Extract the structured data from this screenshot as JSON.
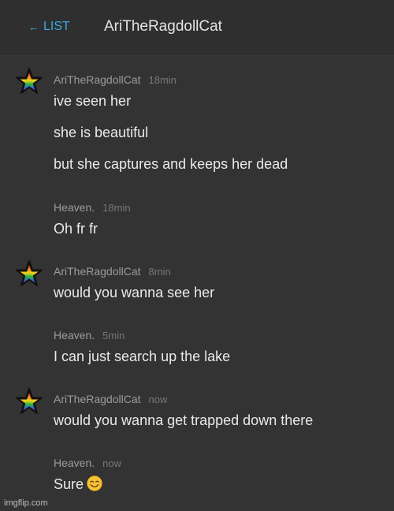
{
  "header": {
    "back_arrow": "←",
    "back_label": "LIST",
    "title": "AriTheRagdollCat"
  },
  "messages": [
    {
      "username": "AriTheRagdollCat",
      "time": "18min",
      "has_avatar": true,
      "lines": [
        "ive seen her",
        "she is beautiful",
        "but she captures and keeps her dead"
      ]
    },
    {
      "username": "Heaven.",
      "time": "18min",
      "has_avatar": false,
      "lines": [
        "Oh fr fr"
      ]
    },
    {
      "username": "AriTheRagdollCat",
      "time": "8min",
      "has_avatar": true,
      "lines": [
        "would you wanna see her"
      ]
    },
    {
      "username": "Heaven.",
      "time": "5min",
      "has_avatar": false,
      "lines": [
        "I can just search up the lake"
      ]
    },
    {
      "username": "AriTheRagdollCat",
      "time": "now",
      "has_avatar": true,
      "lines": [
        "would you wanna get trapped down there"
      ]
    },
    {
      "username": "Heaven.",
      "time": "now",
      "has_avatar": false,
      "lines": [
        "Sure"
      ],
      "emoji": "smiling-face-emoji"
    }
  ],
  "watermark": "imgflip.com",
  "colors": {
    "background": "#333333",
    "link": "#3ba9e0",
    "username": "#9c9c9c",
    "message_text": "#eaeaea"
  }
}
